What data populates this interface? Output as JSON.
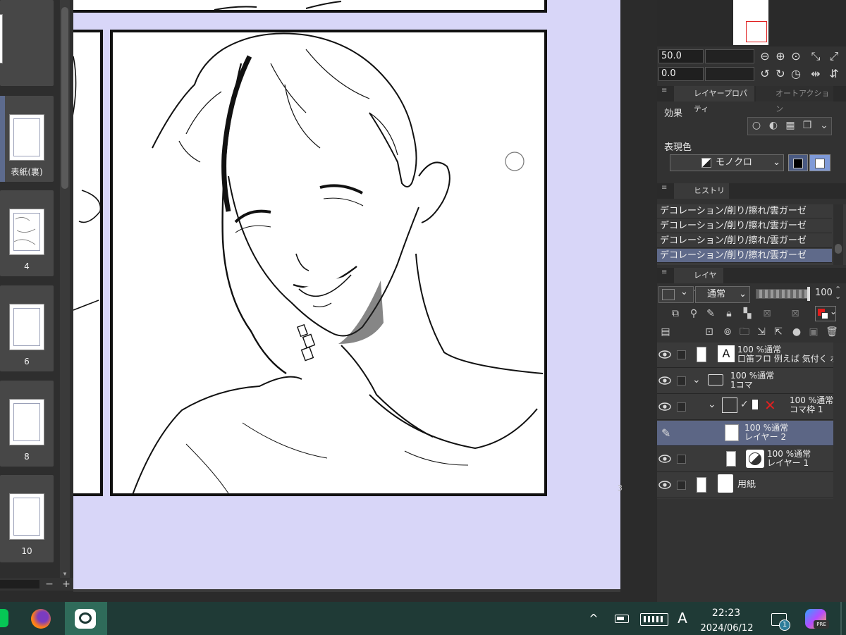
{
  "pages": {
    "cover_back_label": "表紙(裏)",
    "items": [
      {
        "label": "4"
      },
      {
        "label": "6"
      },
      {
        "label": "8"
      },
      {
        "label": "10"
      }
    ]
  },
  "page_zoom": {
    "minus": "−",
    "plus": "+"
  },
  "navigator": {
    "zoom_value": "50.0",
    "rotate_value": "0.0"
  },
  "layer_property": {
    "tab_label": "レイヤープロパティ",
    "tab2_label": "オートアクション",
    "effect_label": "効果",
    "expression_color_label": "表現色",
    "expression_color_value": "モノクロ"
  },
  "history": {
    "tab_label": "ヒストリー",
    "rows": [
      "デコレーション/削り/擦れ/雲ガーゼ",
      "デコレーション/削り/擦れ/雲ガーゼ",
      "デコレーション/削り/擦れ/雲ガーゼ",
      "デコレーション/削り/擦れ/雲ガーゼ"
    ]
  },
  "layers": {
    "tab_label": "レイヤー",
    "blend_mode": "通常",
    "opacity": "100",
    "rows": [
      {
        "line1": "100 %通常",
        "line2": "口笛フロ 例えば 気付く ボクの"
      },
      {
        "line1": "100 %通常",
        "line2": "1コマ"
      },
      {
        "line1": "100 %通常",
        "line2": "コマ枠 1"
      },
      {
        "line1": "100 %通常",
        "line2": "レイヤー 2"
      },
      {
        "line1": "100 %通常",
        "line2": "レイヤー 1"
      },
      {
        "line1": "",
        "line2": "用紙"
      }
    ]
  },
  "canvas": {
    "edge_mark": "3"
  },
  "taskbar": {
    "time": "22:23",
    "date": "2024/06/12",
    "ime": "A",
    "notification_count": "1",
    "copilot_badge": "PRE",
    "chevron": "^"
  },
  "colors": {
    "canvas_bg": "#d8d6f8",
    "selected_row": "#5c6685",
    "taskbar_bg": "#1f3a36"
  }
}
